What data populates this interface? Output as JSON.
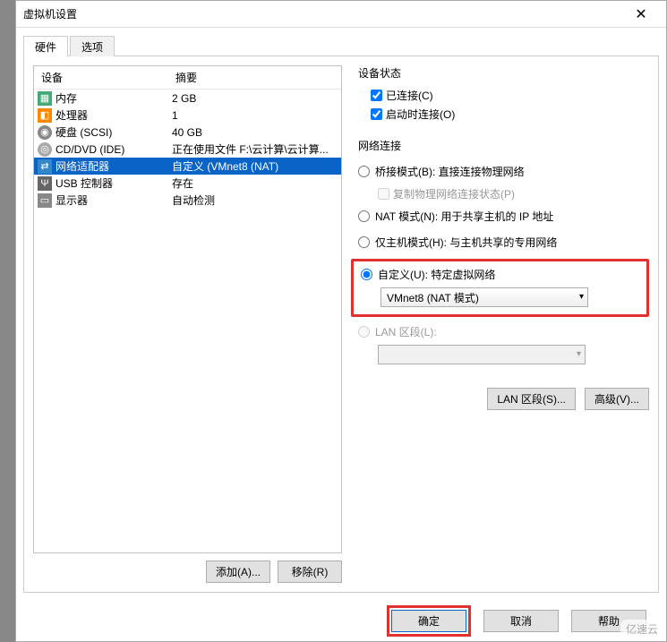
{
  "window": {
    "title": "虚拟机设置",
    "close": "✕"
  },
  "tabs": {
    "hardware": "硬件",
    "options": "选项"
  },
  "columns": {
    "device": "设备",
    "summary": "摘要"
  },
  "devices": [
    {
      "icon": "memory-icon",
      "name": "内存",
      "summary": "2 GB"
    },
    {
      "icon": "cpu-icon",
      "name": "处理器",
      "summary": "1"
    },
    {
      "icon": "hdd-icon",
      "name": "硬盘 (SCSI)",
      "summary": "40 GB"
    },
    {
      "icon": "cd-icon",
      "name": "CD/DVD (IDE)",
      "summary": "正在使用文件 F:\\云计算\\云计算..."
    },
    {
      "icon": "network-icon",
      "name": "网络适配器",
      "summary": "自定义 (VMnet8 (NAT)"
    },
    {
      "icon": "usb-icon",
      "name": "USB 控制器",
      "summary": "存在"
    },
    {
      "icon": "display-icon",
      "name": "显示器",
      "summary": "自动检测"
    }
  ],
  "buttons": {
    "add": "添加(A)...",
    "remove": "移除(R)",
    "lan_seg": "LAN 区段(S)...",
    "advanced": "高级(V)...",
    "ok": "确定",
    "cancel": "取消",
    "help": "帮助"
  },
  "status": {
    "title": "设备状态",
    "connected": "已连接(C)",
    "connect_on": "启动时连接(O)"
  },
  "net": {
    "title": "网络连接",
    "bridged": "桥接模式(B): 直接连接物理网络",
    "replicate": "复制物理网络连接状态(P)",
    "nat": "NAT 模式(N): 用于共享主机的 IP 地址",
    "hostonly": "仅主机模式(H): 与主机共享的专用网络",
    "custom": "自定义(U): 特定虚拟网络",
    "custom_value": "VMnet8 (NAT 模式)",
    "lan": "LAN 区段(L):",
    "lan_value": ""
  },
  "watermark": "亿速云"
}
